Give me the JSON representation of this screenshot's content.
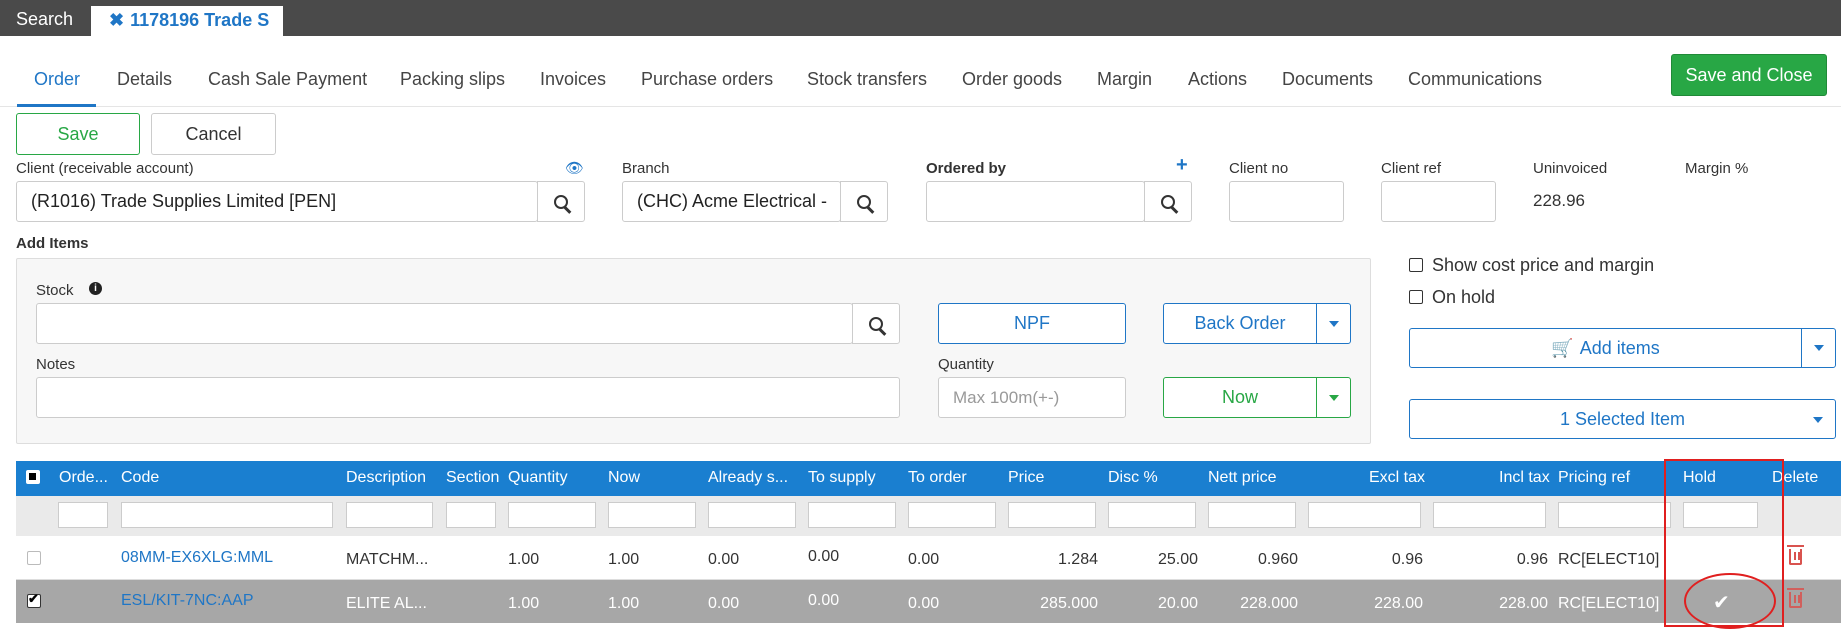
{
  "topbar": {
    "search_label": "Search",
    "tab_close": "✖",
    "tab_label": "1178196 Trade S"
  },
  "nav": {
    "tabs": [
      "Order",
      "Details",
      "Cash Sale Payment",
      "Packing slips",
      "Invoices",
      "Purchase orders",
      "Stock transfers",
      "Order goods",
      "Margin",
      "Actions",
      "Documents",
      "Communications"
    ],
    "active": "Order",
    "save_close": "Save and Close"
  },
  "actions": {
    "save": "Save",
    "cancel": "Cancel"
  },
  "header_fields": {
    "client_label": "Client (receivable account)",
    "client_value": "(R1016) Trade Supplies Limited [PEN]",
    "branch_label": "Branch",
    "branch_value": "(CHC) Acme Electrical -",
    "ordered_by_label": "Ordered by",
    "ordered_by_value": "",
    "client_no_label": "Client no",
    "client_no_value": "",
    "client_ref_label": "Client ref",
    "client_ref_value": "",
    "uninvoiced_label": "Uninvoiced",
    "uninvoiced_value": "228.96",
    "margin_label": "Margin %",
    "margin_value": ""
  },
  "add_items": {
    "section_label": "Add Items",
    "stock_label": "Stock",
    "stock_value": "",
    "notes_label": "Notes",
    "notes_value": "",
    "npf": "NPF",
    "back_order": "Back Order",
    "quantity_label": "Quantity",
    "quantity_placeholder": "Max 100m(+-)",
    "now": "Now"
  },
  "options": {
    "show_cost": "Show cost price and margin",
    "on_hold": "On hold",
    "add_items": "Add items",
    "selected_item": "1 Selected Item"
  },
  "grid": {
    "columns": [
      "Orde...",
      "Code",
      "Description",
      "Section",
      "Quantity",
      "Now",
      "Already s...",
      "To supply",
      "To order",
      "Price",
      "Disc %",
      "Nett price",
      "Excl tax",
      "Incl tax",
      "Pricing ref",
      "Hold",
      "Delete"
    ],
    "rows": [
      {
        "checked": false,
        "code": "08MM-EX6XLG:MML",
        "description": "MATCHM...",
        "section": "",
        "quantity": "1.00",
        "now": "1.00",
        "already": "0.00",
        "to_supply": "0.00",
        "to_order": "0.00",
        "price": "1.284",
        "disc": "25.00",
        "nett": "0.960",
        "excl": "0.96",
        "incl": "0.96",
        "pricing_ref": "RC[ELECT10]",
        "hold": ""
      },
      {
        "checked": true,
        "code": "ESL/KIT-7NC:AAP",
        "description": "ELITE AL...",
        "section": "",
        "quantity": "1.00",
        "now": "1.00",
        "already": "0.00",
        "to_supply": "0.00",
        "to_order": "0.00",
        "price": "285.000",
        "disc": "20.00",
        "nett": "228.000",
        "excl": "228.00",
        "incl": "228.00",
        "pricing_ref": "RC[ELECT10]",
        "hold": "✔"
      }
    ]
  }
}
